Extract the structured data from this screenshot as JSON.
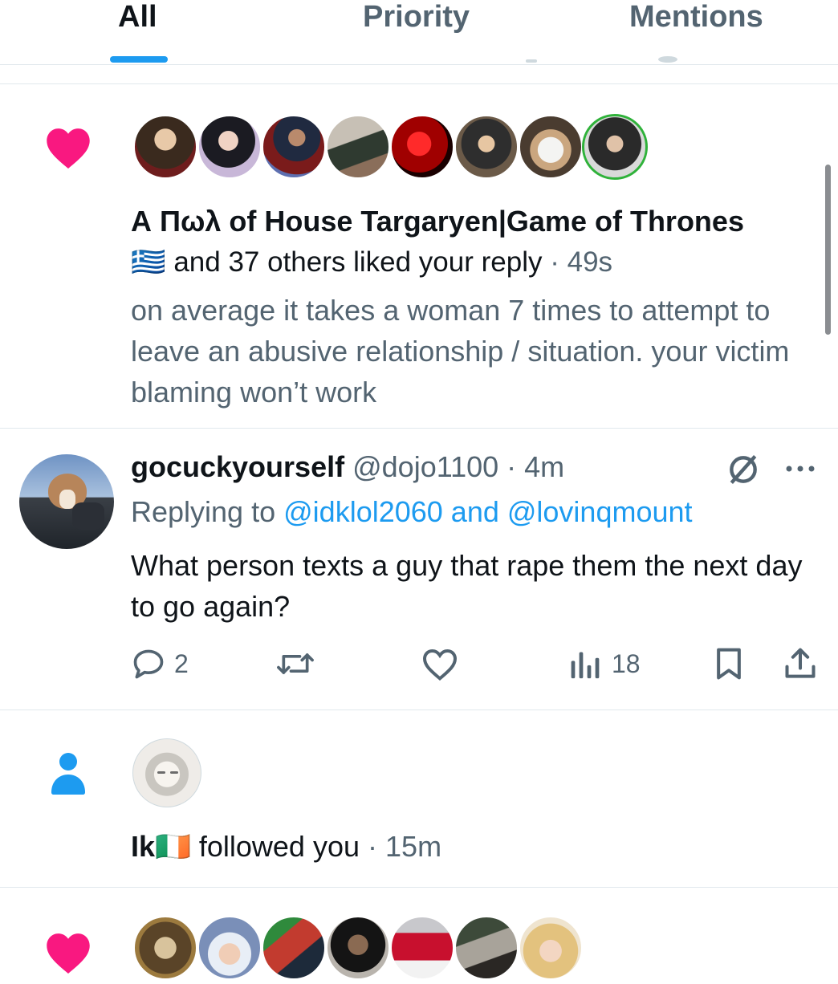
{
  "tabs": [
    {
      "label": "All",
      "active": true
    },
    {
      "label": "Priority",
      "active": false
    },
    {
      "label": "Mentions",
      "active": false
    }
  ],
  "colors": {
    "accent": "#1d9bf0",
    "like": "#f91880",
    "text": "#0f1419",
    "secondary": "#536471"
  },
  "notification_like": {
    "icon": "heart-icon",
    "actor_name": "Α Πωλ of House Targaryen|Game of Thrones",
    "flag": "🇬🇷",
    "summary": "and 37 others liked your reply",
    "time": "· 49s",
    "reply_text": "on average it takes a woman 7 times to attempt to leave an abusive relationship / situation. your victim blaming won’t work"
  },
  "reply_tweet": {
    "display_name": "gocuckyourself",
    "handle": "@dojo1100",
    "time": "· 4m",
    "replying_prefix": "Replying to",
    "replying_to": "@idklol2060 and @lovinqmount",
    "text": "What person texts a guy that rape them the next day to go again?",
    "actions": {
      "replies": "2",
      "retweets": "",
      "likes": "",
      "views": "18"
    }
  },
  "notification_follow": {
    "icon": "person-icon",
    "name": "Ik",
    "flag": "🇮🇪",
    "text": "followed you",
    "time": "· 15m"
  }
}
